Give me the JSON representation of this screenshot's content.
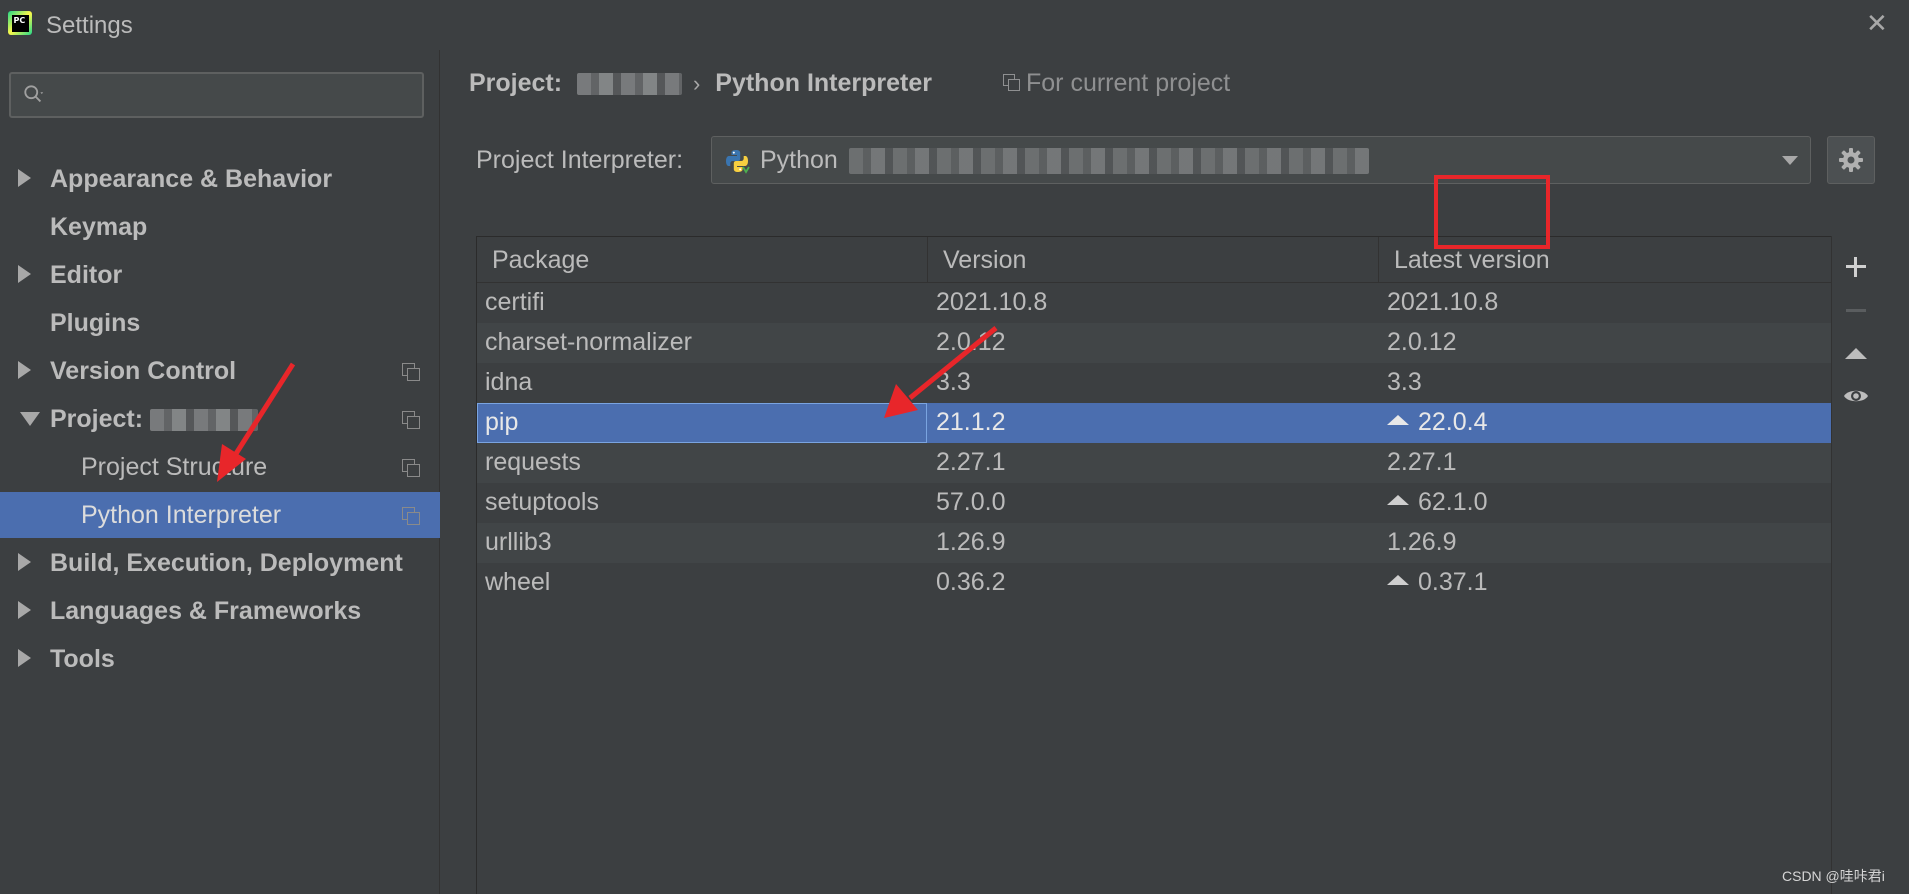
{
  "window": {
    "title": "Settings",
    "app_icon_text": "PC"
  },
  "sidebar": {
    "search": {
      "placeholder": "",
      "value": ""
    },
    "items": [
      {
        "label": "Appearance & Behavior",
        "expandable": true,
        "expanded": false
      },
      {
        "label": "Keymap",
        "expandable": false
      },
      {
        "label": "Editor",
        "expandable": true,
        "expanded": false
      },
      {
        "label": "Plugins",
        "expandable": false
      },
      {
        "label": "Version Control",
        "expandable": true,
        "expanded": false,
        "icon": "copy-icon"
      },
      {
        "label": "Project: ",
        "expandable": true,
        "expanded": true,
        "icon": "copy-icon"
      },
      {
        "label": "Project Structure",
        "sub": true,
        "icon": "copy-icon"
      },
      {
        "label": "Python Interpreter",
        "sub": true,
        "selected": true,
        "icon": "copy-icon"
      },
      {
        "label": "Build, Execution, Deployment",
        "expandable": true,
        "expanded": false
      },
      {
        "label": "Languages & Frameworks",
        "expandable": true,
        "expanded": false
      },
      {
        "label": "Tools",
        "expandable": true,
        "expanded": false
      }
    ]
  },
  "main": {
    "breadcrumb": {
      "project_label": "Project:",
      "separator": "›",
      "current": "Python Interpreter"
    },
    "for_current_project": "For current project",
    "interpreter": {
      "label": "Project Interpreter:",
      "value": "Python"
    }
  },
  "packages": {
    "columns": [
      "Package",
      "Version",
      "Latest version"
    ],
    "rows": [
      {
        "package": "certifi",
        "version": "2021.10.8",
        "latest": "2021.10.8",
        "upgrade": false
      },
      {
        "package": "charset-normalizer",
        "version": "2.0.12",
        "latest": "2.0.12",
        "upgrade": false
      },
      {
        "package": "idna",
        "version": "3.3",
        "latest": "3.3",
        "upgrade": false
      },
      {
        "package": "pip",
        "version": "21.1.2",
        "latest": "22.0.4",
        "upgrade": true,
        "selected": true
      },
      {
        "package": "requests",
        "version": "2.27.1",
        "latest": "2.27.1",
        "upgrade": false
      },
      {
        "package": "setuptools",
        "version": "57.0.0",
        "latest": "62.1.0",
        "upgrade": true
      },
      {
        "package": "urllib3",
        "version": "1.26.9",
        "latest": "1.26.9",
        "upgrade": false
      },
      {
        "package": "wheel",
        "version": "0.36.2",
        "latest": "0.37.1",
        "upgrade": true
      }
    ]
  },
  "actions": [
    "add-package",
    "remove-package",
    "upgrade-package",
    "show-early-releases"
  ],
  "watermark": "CSDN @哇咔君i",
  "colors": {
    "background": "#3c3f41",
    "selection": "#4b6eaf",
    "annotation": "#e8262a"
  }
}
